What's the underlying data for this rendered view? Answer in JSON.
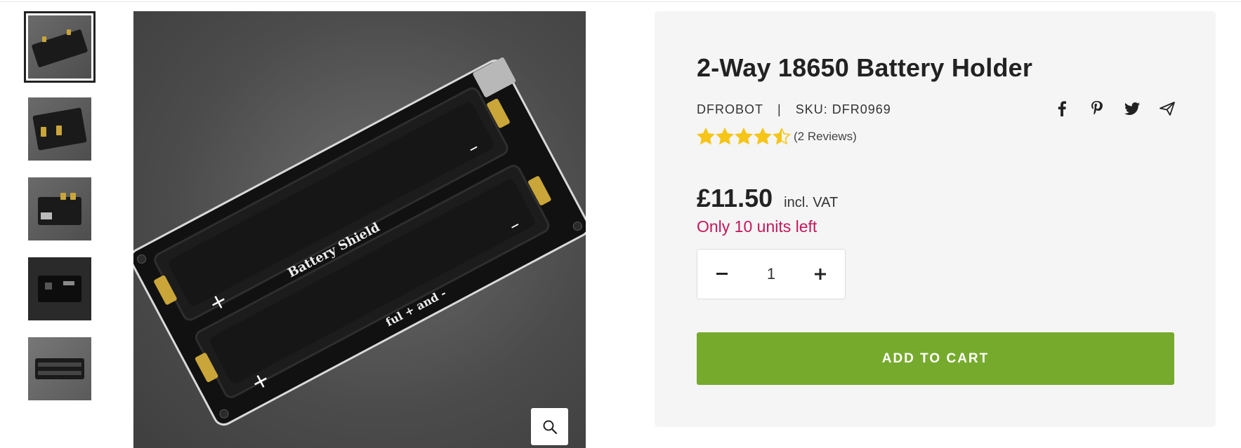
{
  "gallery": {
    "thumbnails": [
      {
        "name": "thumb-1",
        "active": true
      },
      {
        "name": "thumb-2",
        "active": false
      },
      {
        "name": "thumb-3",
        "active": false
      },
      {
        "name": "thumb-4",
        "active": false
      },
      {
        "name": "thumb-5",
        "active": false
      }
    ],
    "zoom_icon": "search-icon",
    "image_text": {
      "line1": "Battery Shield",
      "line2": "ful + and -"
    }
  },
  "product": {
    "title": "2-Way 18650 Battery Holder",
    "brand": "DFROBOT",
    "separator": "|",
    "sku": "SKU: DFR0969",
    "rating_value": 4.5,
    "rating_max": 5,
    "reviews": "(2 Reviews)",
    "price": "£11.50",
    "vat_label": "incl. VAT",
    "stock": "Only 10 units left",
    "quantity": "1",
    "add_to_cart": "ADD TO CART"
  },
  "share": {
    "icons": [
      "facebook-icon",
      "pinterest-icon",
      "twitter-icon",
      "send-icon"
    ]
  },
  "colors": {
    "accent_green": "#76aa2d",
    "stock_red": "#c2185b",
    "star_gold": "#f5c518",
    "panel_bg": "#f5f5f5"
  }
}
